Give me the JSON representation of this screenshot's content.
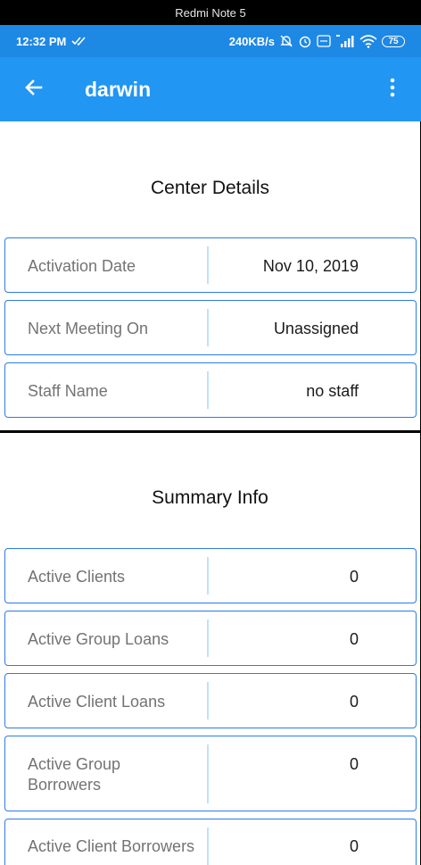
{
  "device": {
    "label": "Redmi Note 5"
  },
  "status_bar": {
    "time": "12:32 PM",
    "network_speed": "240KB/s",
    "battery": "75",
    "icons": [
      "double-check-icon",
      "mute-icon",
      "alarm-icon",
      "volte-icon",
      "signal-4g-icon",
      "wifi-icon",
      "battery-icon"
    ]
  },
  "app_bar": {
    "title": "darwin",
    "back_icon": "arrow-back-icon",
    "menu_icon": "more-vert-icon"
  },
  "center_details": {
    "title": "Center Details",
    "rows": [
      {
        "label": "Activation Date",
        "value": "Nov 10, 2019"
      },
      {
        "label": "Next Meeting On",
        "value": "Unassigned"
      },
      {
        "label": "Staff Name",
        "value": "no staff"
      }
    ]
  },
  "summary_info": {
    "title": "Summary Info",
    "rows": [
      {
        "label": "Active Clients",
        "value": "0"
      },
      {
        "label": "Active Group Loans",
        "value": "0"
      },
      {
        "label": "Active Client Loans",
        "value": "0"
      },
      {
        "label": "Active Group Borrowers",
        "value": "0"
      },
      {
        "label": "Active Client Borrowers",
        "value": "0"
      }
    ]
  },
  "colors": {
    "status_bar": "#1e88e5",
    "app_bar": "#2196f3",
    "row_border": "#2d7be5",
    "row_divider": "#bfe1fb"
  }
}
